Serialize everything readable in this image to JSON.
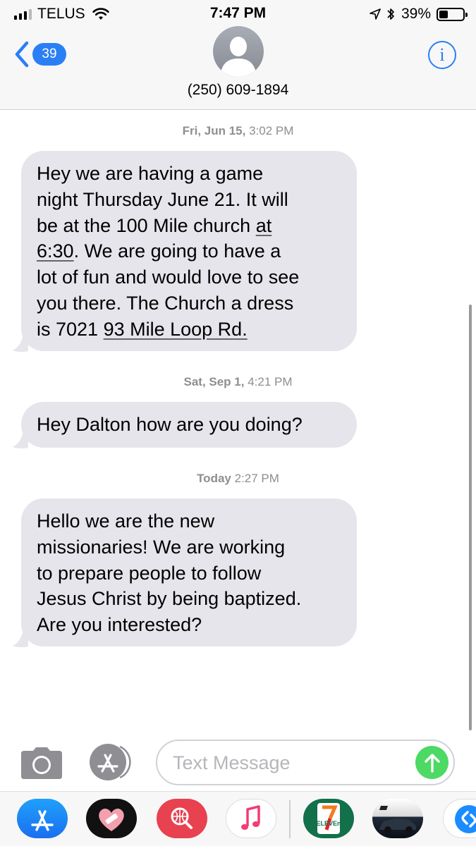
{
  "status_bar": {
    "carrier": "TELUS",
    "time": "7:47 PM",
    "battery_percent": "39%",
    "battery_level": 0.39,
    "signal_bars": 3
  },
  "header": {
    "unread_count": "39",
    "contact": "(250) 609-1894",
    "info_icon": "i"
  },
  "conversation": [
    {
      "timestamp_day": "Fri, Jun 15,",
      "timestamp_time": "3:02 PM",
      "lines": [
        [
          {
            "t": "Hey we are having a game"
          }
        ],
        [
          {
            "t": "night Thursday June 21. It will"
          }
        ],
        [
          {
            "t": "be at the 100 Mile church "
          },
          {
            "t": "at",
            "link": true
          }
        ],
        [
          {
            "t": "6:30",
            "link": true
          },
          {
            "t": ". We are going to have a"
          }
        ],
        [
          {
            "t": "lot of fun and would love to see"
          }
        ],
        [
          {
            "t": "you there. The Church a dress"
          }
        ],
        [
          {
            "t": "is 7021 "
          },
          {
            "t": "93 Mile Loop Rd.",
            "link": true
          }
        ]
      ]
    },
    {
      "timestamp_day": "Sat, Sep 1,",
      "timestamp_time": "4:21 PM",
      "lines": [
        [
          {
            "t": "Hey Dalton how are you doing?"
          }
        ]
      ]
    },
    {
      "timestamp_day": "Today",
      "timestamp_time": "2:27 PM",
      "lines": [
        [
          {
            "t": "Hello we are the new"
          }
        ],
        [
          {
            "t": "missionaries! We are working"
          }
        ],
        [
          {
            "t": "to prepare people to follow"
          }
        ],
        [
          {
            "t": "Jesus Christ by being baptized."
          }
        ],
        [
          {
            "t": "Are you interested?"
          }
        ]
      ]
    }
  ],
  "composer": {
    "placeholder": "Text Message",
    "value": ""
  },
  "app_drawer": [
    {
      "name": "app-store-app-icon"
    },
    {
      "name": "heart-sticker-app-icon"
    },
    {
      "name": "web-search-app-icon"
    },
    {
      "name": "music-app-icon"
    },
    {
      "name": "seven-eleven-app-icon",
      "label": "ELEVEn"
    },
    {
      "name": "car-sticker-app-icon"
    },
    {
      "name": "shazam-app-icon"
    }
  ],
  "colors": {
    "accent": "#2a7ff5",
    "bubble_incoming": "#e6e5eb",
    "send": "#4cd964",
    "timestamp": "#8e8e93"
  }
}
